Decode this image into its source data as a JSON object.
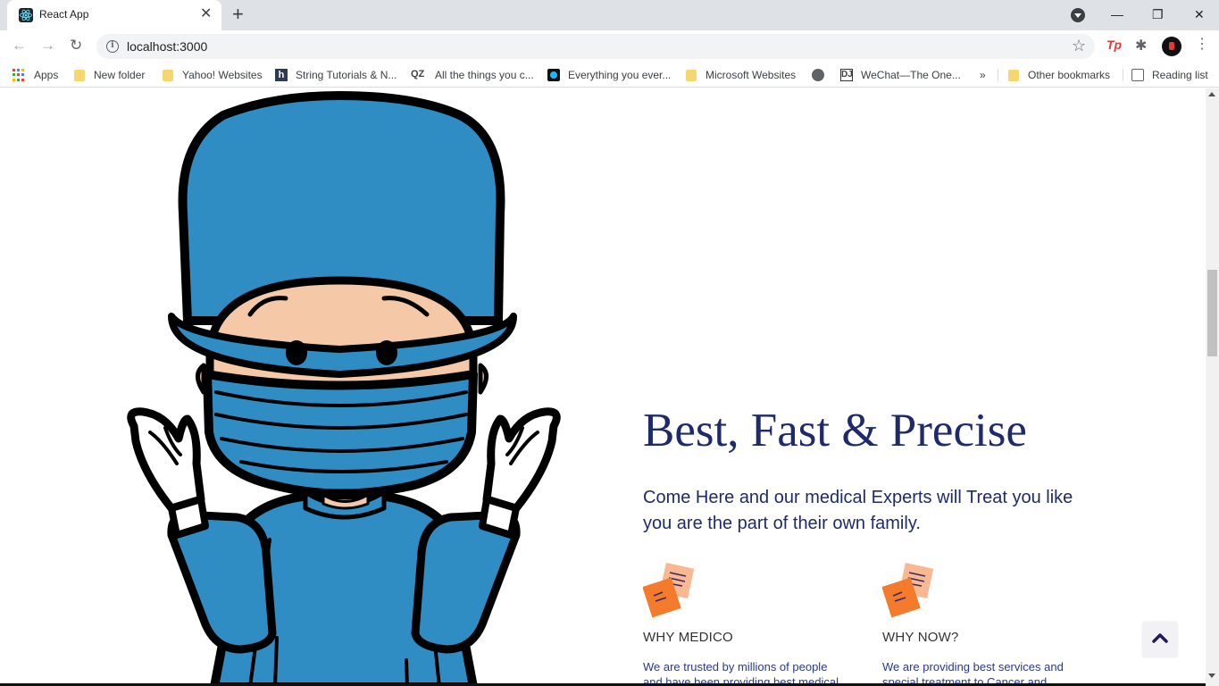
{
  "browser": {
    "tab_title": "React App",
    "tab_close": "✕",
    "new_tab": "+",
    "url": "localhost:3000",
    "win_minimize": "—",
    "win_restore": "❐",
    "win_close": "✕",
    "back": "←",
    "forward": "→",
    "reload": "↻",
    "star": "☆",
    "ext_tp": "Tp",
    "ext_puzzle": "✱",
    "menu": "⋮",
    "info": "i"
  },
  "bookmarks": {
    "items": [
      "Apps",
      "New folder",
      "Yahoo! Websites",
      "String Tutorials & N...",
      "All the things you c...",
      "Everything you ever...",
      "Microsoft Websites",
      "",
      "WeChat—The One...",
      "»",
      "Other bookmarks",
      "Reading list"
    ],
    "icons": {
      "h": "h",
      "qz": "QZ",
      "dj": "DJ"
    }
  },
  "hero": {
    "headline": "Best, Fast & Precise",
    "subtext": "Come Here and our medical Experts will Treat you like you are the part of their own family."
  },
  "features": [
    {
      "title": "WHY MEDICO",
      "text": "We are trusted by millions of people and have been providing best medical"
    },
    {
      "title": "WHY NOW?",
      "text": "We are providing best services and special treatment to Cancer and"
    }
  ],
  "colors": {
    "heading": "#1f2a6b",
    "body_text": "#2a3a8e",
    "scrub_blue": "#2f8dc4",
    "skin": "#f5c9a8",
    "note_orange": "#f47a2c",
    "note_peach": "#f7b892"
  }
}
